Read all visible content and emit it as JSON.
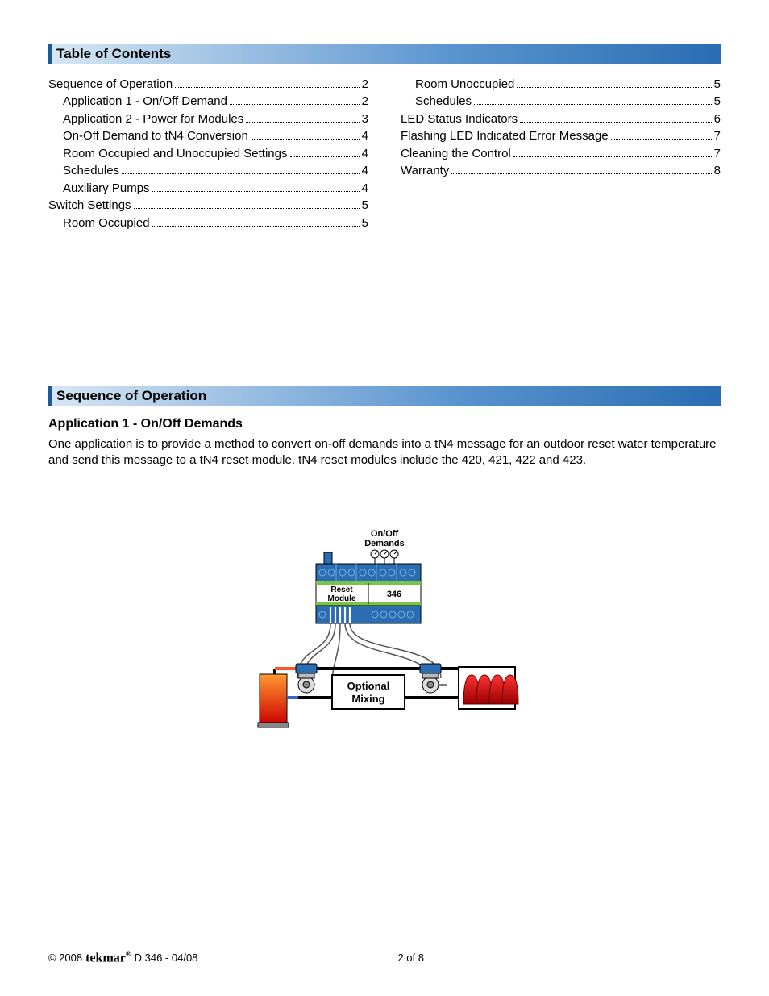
{
  "headings": {
    "toc": "Table of Contents",
    "seq": "Sequence of Operation",
    "app1": "Application 1 - On/Off Demands"
  },
  "toc_left": [
    {
      "title": "Sequence of Operation",
      "page": "2",
      "indent": 0
    },
    {
      "title": "Application 1 - On/Off Demand",
      "page": "2",
      "indent": 1
    },
    {
      "title": "Application 2 - Power for Modules",
      "page": "3",
      "indent": 1
    },
    {
      "title": "On-Off Demand to tN4 Conversion",
      "page": "4",
      "indent": 1
    },
    {
      "title": "Room Occupied and Unoccupied Settings",
      "page": "4",
      "indent": 1
    },
    {
      "title": "Schedules",
      "page": "4",
      "indent": 1
    },
    {
      "title": "Auxiliary Pumps",
      "page": "4",
      "indent": 1
    },
    {
      "title": "Switch Settings",
      "page": "5",
      "indent": 0
    },
    {
      "title": "Room Occupied",
      "page": "5",
      "indent": 1
    }
  ],
  "toc_right": [
    {
      "title": "Room Unoccupied",
      "page": "5",
      "indent": 1
    },
    {
      "title": "Schedules",
      "page": "5",
      "indent": 1
    },
    {
      "title": "LED Status Indicators",
      "page": "6",
      "indent": 0
    },
    {
      "title": "Flashing LED Indicated Error Message",
      "page": "7",
      "indent": 0
    },
    {
      "title": "Cleaning the Control",
      "page": "7",
      "indent": 0
    },
    {
      "title": "Warranty",
      "page": "8",
      "indent": 0
    }
  ],
  "app1_body": "One application is to provide a method to convert on-off demands into a tN4 message for an outdoor reset water temperature and send this message to a tN4 reset module. tN4 reset modules include the 420, 421, 422 and 423.",
  "diagram": {
    "demands_label_1": "On/Off",
    "demands_label_2": "Demands",
    "reset_label_1": "Reset",
    "reset_label_2": "Module",
    "model": "346",
    "mixing_1": "Optional",
    "mixing_2": "Mixing"
  },
  "footer": {
    "copyright": "© 2008",
    "brand": "tekmar",
    "docid": "D 346 - 04/08",
    "pager": "2 of 8"
  }
}
